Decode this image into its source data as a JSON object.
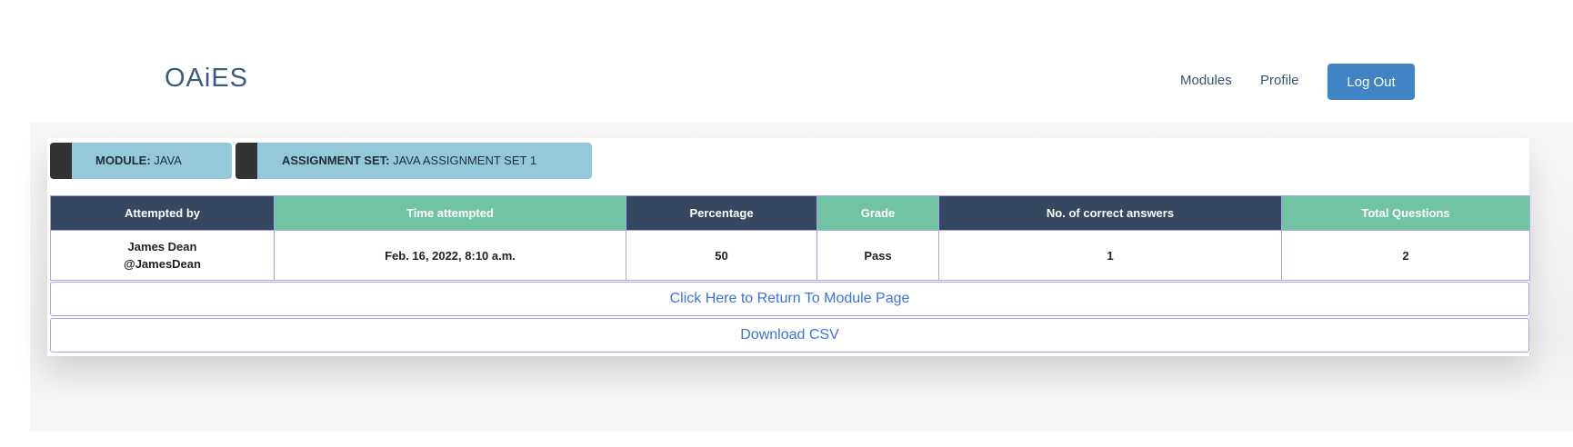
{
  "navbar": {
    "brand": "OAiES",
    "links": {
      "modules": "Modules",
      "profile": "Profile"
    },
    "logout_label": "Log Out",
    "logout_color": "#4084c6"
  },
  "tags": {
    "module": {
      "label": "MODULE:",
      "value": "JAVA"
    },
    "assignment": {
      "label": "ASSIGNMENT SET:",
      "value": "JAVA ASSIGNMENT SET 1"
    }
  },
  "table": {
    "headers": [
      "Attempted by",
      "Time attempted",
      "Percentage",
      "Grade",
      "No. of correct answers",
      "Total Questions"
    ],
    "rows": [
      {
        "attempted_by_name": "James Dean",
        "attempted_by_handle": "@JamesDean",
        "time_attempted": "Feb. 16, 2022, 8:10 a.m.",
        "percentage": "50",
        "grade": "Pass",
        "correct_answers": "1",
        "total_questions": "2"
      }
    ]
  },
  "actions": {
    "return_label": "Click Here to Return To Module Page",
    "download_label": "Download CSV"
  },
  "colors": {
    "header_dark": "#364861",
    "header_green": "#72c3a3",
    "tag_bg": "#95c9da",
    "link_blue": "#3b74e0"
  }
}
